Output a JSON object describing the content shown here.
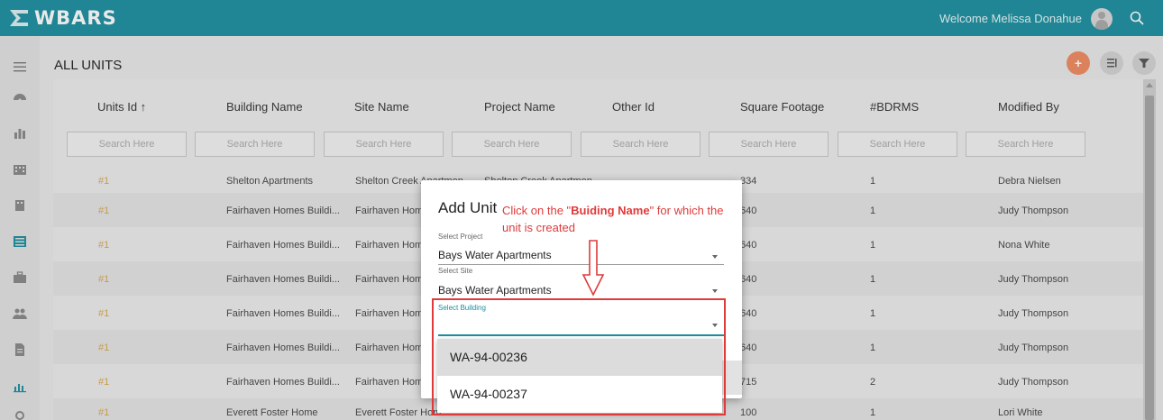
{
  "app": {
    "logo_text": "WBARS",
    "welcome": "Welcome Melissa Donahue"
  },
  "page": {
    "title": "ALL UNITS"
  },
  "colors": {
    "brand": "#1b8fa0",
    "accent": "#f08a5f",
    "annotation": "#e03a3a",
    "id_link": "#d9a84a"
  },
  "sidebar": {
    "icons": [
      "menu-icon",
      "dashboard-icon",
      "analytics-icon",
      "building-icon",
      "site-icon",
      "units-icon",
      "briefcase-icon",
      "users-icon",
      "document-icon",
      "chart-icon",
      "settings-icon"
    ]
  },
  "table": {
    "columns": [
      "Units Id ↑",
      "Building Name",
      "Site Name",
      "Project Name",
      "Other Id",
      "Square Footage",
      "#BDRMS",
      "Modified By"
    ],
    "search_placeholder": "Search Here",
    "rows": [
      {
        "id": "#1",
        "building": "Shelton Apartments",
        "site": "Shelton Creek Apartmen",
        "project": "Shelton Creek Apartmen",
        "other": "",
        "sqft": "334",
        "bdrms": "1",
        "modified": "Debra Nielsen"
      },
      {
        "id": "#1",
        "building": "Fairhaven Homes Buildi...",
        "site": "Fairhaven Home",
        "project": "",
        "other": "",
        "sqft": "640",
        "bdrms": "1",
        "modified": "Judy Thompson"
      },
      {
        "id": "#1",
        "building": "Fairhaven Homes Buildi...",
        "site": "Fairhaven Home",
        "project": "",
        "other": "",
        "sqft": "640",
        "bdrms": "1",
        "modified": "Nona White"
      },
      {
        "id": "#1",
        "building": "Fairhaven Homes Buildi...",
        "site": "Fairhaven Home",
        "project": "",
        "other": "",
        "sqft": "640",
        "bdrms": "1",
        "modified": "Judy Thompson"
      },
      {
        "id": "#1",
        "building": "Fairhaven Homes Buildi...",
        "site": "Fairhaven Home",
        "project": "",
        "other": "",
        "sqft": "640",
        "bdrms": "1",
        "modified": "Judy Thompson"
      },
      {
        "id": "#1",
        "building": "Fairhaven Homes Buildi...",
        "site": "Fairhaven Home",
        "project": "",
        "other": "",
        "sqft": "640",
        "bdrms": "1",
        "modified": "Judy Thompson"
      },
      {
        "id": "#1",
        "building": "Fairhaven Homes Buildi...",
        "site": "Fairhaven Home",
        "project": "",
        "other": "",
        "sqft": "715",
        "bdrms": "2",
        "modified": "Judy Thompson"
      },
      {
        "id": "#1",
        "building": "Everett Foster Home",
        "site": "Everett Foster Hom",
        "project": "",
        "other": "",
        "sqft": "100",
        "bdrms": "1",
        "modified": "Lori White"
      }
    ]
  },
  "dialog": {
    "title": "Add Unit",
    "project_label": "Select Project",
    "project_value": "Bays Water Apartments",
    "site_label": "Select Site",
    "site_value": "Bays Water Apartments",
    "building_label": "Select Building",
    "building_value": ""
  },
  "dropdown": {
    "options": [
      "WA-94-00236",
      "WA-94-00237"
    ]
  },
  "annotation": {
    "prefix": "Click on the \"",
    "highlight": "Buiding Name",
    "suffix": "\" for which the unit is created"
  }
}
